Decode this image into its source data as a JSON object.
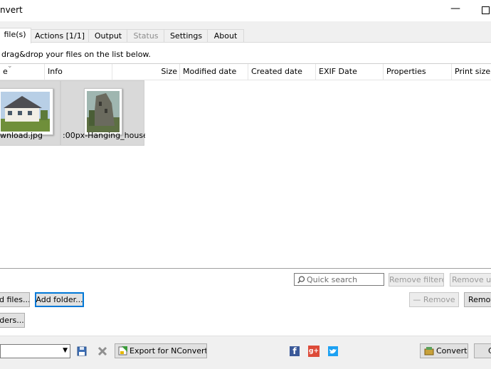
{
  "window": {
    "title": "nvert",
    "minimize_glyph": "—"
  },
  "tabs": [
    {
      "label": "file(s)",
      "active": true,
      "enabled": true
    },
    {
      "label": "Actions [1/1]",
      "active": false,
      "enabled": true
    },
    {
      "label": "Output",
      "active": false,
      "enabled": true
    },
    {
      "label": "Status",
      "active": false,
      "enabled": false
    },
    {
      "label": "Settings",
      "active": false,
      "enabled": true
    },
    {
      "label": "About",
      "active": false,
      "enabled": true
    }
  ],
  "hint": "drag&drop your files on the list below.",
  "list": {
    "columns": [
      "e",
      "Info",
      "Size",
      "Modified date",
      "Created date",
      "EXIF Date",
      "Properties",
      "Print size"
    ],
    "files": [
      {
        "name": "wnload.jpg"
      },
      {
        "name": ":00px-Hanging_house..."
      }
    ]
  },
  "search": {
    "placeholder": "Quick search"
  },
  "buttons": {
    "remove_filtered": "Remove filtered",
    "remove_unfiltered": "Remove unf",
    "add_files": "d files...",
    "add_folder": "Add folder...",
    "remove": "Remove",
    "remove_all": "Remov",
    "folders": "ders...",
    "export": "Export for NConvert...",
    "convert": "Convert",
    "close": "C"
  },
  "icons": {
    "save": "save-icon",
    "clear": "clear-icon",
    "facebook": "facebook-icon",
    "googleplus": "googleplus-icon",
    "twitter": "twitter-icon"
  },
  "colors": {
    "facebook": "#3b5998",
    "googleplus": "#dd4b39",
    "twitter": "#1da1f2"
  }
}
